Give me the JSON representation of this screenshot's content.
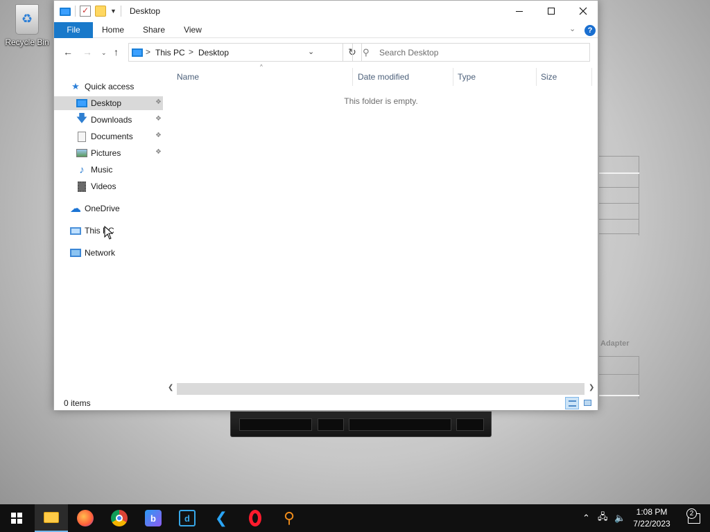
{
  "desktop": {
    "recycle_bin_label": "Recycle Bin",
    "background_text": "Adapter"
  },
  "window": {
    "title": "Desktop",
    "ribbon_tabs": [
      "File",
      "Home",
      "Share",
      "View"
    ],
    "help_label": "?",
    "address": {
      "crumbs": [
        "This PC",
        "Desktop"
      ],
      "separator": ">"
    },
    "search": {
      "placeholder": "Search Desktop"
    },
    "nav": {
      "quick_access": "Quick access",
      "quick_items": [
        {
          "label": "Desktop",
          "icon": "desktop-folder-icon",
          "pinned": true,
          "selected": true
        },
        {
          "label": "Downloads",
          "icon": "downloads-icon",
          "pinned": true
        },
        {
          "label": "Documents",
          "icon": "documents-icon",
          "pinned": true
        },
        {
          "label": "Pictures",
          "icon": "pictures-icon",
          "pinned": true
        },
        {
          "label": "Music",
          "icon": "music-icon",
          "pinned": false
        },
        {
          "label": "Videos",
          "icon": "videos-icon",
          "pinned": false
        }
      ],
      "onedrive": "OneDrive",
      "this_pc": "This PC",
      "network": "Network"
    },
    "columns": [
      "Name",
      "Date modified",
      "Type",
      "Size"
    ],
    "empty_message": "This folder is empty.",
    "status": "0 items"
  },
  "taskbar": {
    "apps": [
      "file-explorer",
      "firefox",
      "chrome",
      "bing",
      "azure-data-studio",
      "visual-studio-code",
      "opera",
      "search-tool"
    ],
    "time": "1:08 PM",
    "date": "7/22/2023",
    "notification_count": "2"
  },
  "colors": {
    "file_tab": "#1979ca",
    "selected_nav": "#d9d9d9",
    "taskbar": "#101010",
    "accent": "#76b9ed"
  }
}
